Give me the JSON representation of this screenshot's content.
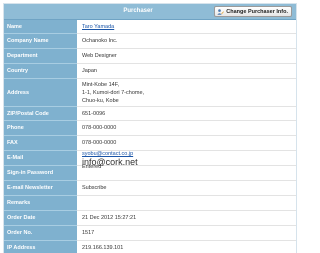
{
  "header": {
    "title": "Purchaser",
    "change_button_label": "Change Purchaser Info."
  },
  "rows": [
    {
      "label": "Name",
      "value": "Taro Yamada"
    },
    {
      "label": "Company Name",
      "value": "Ochanoko Inc."
    },
    {
      "label": "Department",
      "value": "Web Designer"
    },
    {
      "label": "Country",
      "value": "Japan"
    },
    {
      "label": "Address",
      "lines": [
        "Mint-Kobe  14F,",
        "1-1, Kumoi-dori 7-chome,",
        "Chuo-ku, Kobe"
      ]
    },
    {
      "label": "ZIP/Postal Code",
      "value": "651-0096"
    },
    {
      "label": "Phone",
      "value": "078-000-0000"
    },
    {
      "label": "FAX",
      "value": "078-000-0000"
    },
    {
      "label": "E-Mail",
      "value_top": "syobu@contact.co.jp",
      "value_bottom": "info@cork.net"
    },
    {
      "label": "Sign-in Password",
      "value": "Entered"
    },
    {
      "label": "E-mail Newsletter",
      "value": "Subscribe"
    },
    {
      "label": "Remarks",
      "value": ""
    },
    {
      "label": "Order Date",
      "value": "21 Dec 2012 15:27:21"
    },
    {
      "label": "Order No.",
      "value": "1517"
    },
    {
      "label": "IP Address",
      "value": "219.166.139.101"
    }
  ]
}
